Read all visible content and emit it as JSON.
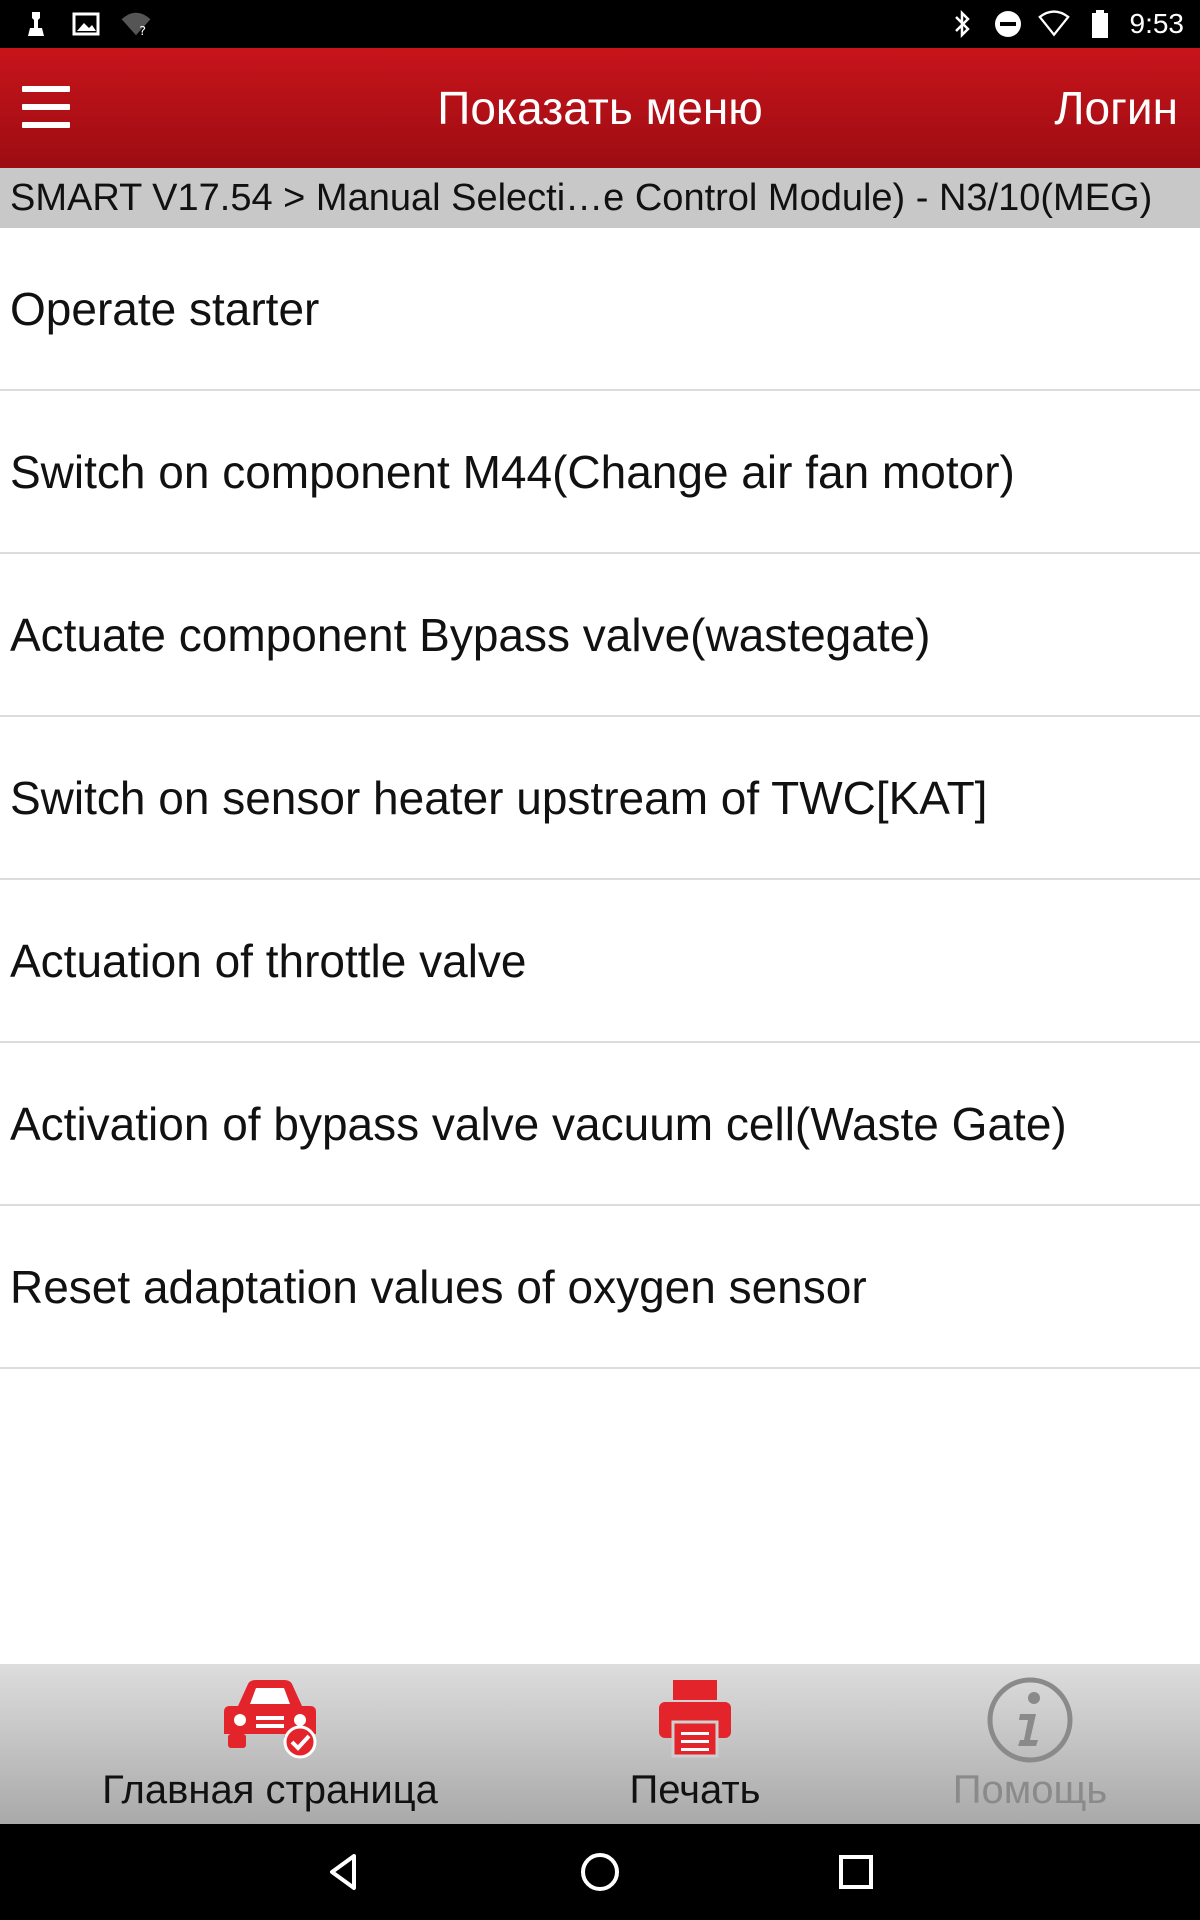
{
  "status_bar": {
    "time": "9:53",
    "icons_left": [
      "notification-icon",
      "image-icon",
      "wifi-unknown-icon"
    ],
    "icons_right": [
      "bluetooth-icon",
      "do-not-disturb-icon",
      "signal-icon",
      "battery-icon"
    ]
  },
  "header": {
    "menu_icon": "hamburger-menu-icon",
    "title": "Показать меню",
    "login": "Логин",
    "color": "#b3111a"
  },
  "breadcrumb": "SMART V17.54 > Manual Selecti…e Control Module) - N3/10(MEG)",
  "list": [
    {
      "label": "Operate starter"
    },
    {
      "label": "Switch on component M44(Change air fan motor)"
    },
    {
      "label": "Actuate component Bypass valve(wastegate)"
    },
    {
      "label": "Switch on sensor heater upstream of TWC[KAT]"
    },
    {
      "label": "Actuation of throttle valve"
    },
    {
      "label": "Activation of bypass valve vacuum cell(Waste Gate)"
    },
    {
      "label": "Reset adaptation values of oxygen sensor"
    }
  ],
  "toolbar": {
    "home": {
      "label": "Главная страница",
      "icon": "car-check-icon"
    },
    "print": {
      "label": "Печать",
      "icon": "printer-icon"
    },
    "help": {
      "label": "Помощь",
      "icon": "info-icon",
      "disabled": true
    }
  },
  "nav_bar": {
    "back": "back-triangle-icon",
    "home": "home-circle-icon",
    "recents": "recents-square-icon"
  },
  "accent_color": "#e3242b"
}
